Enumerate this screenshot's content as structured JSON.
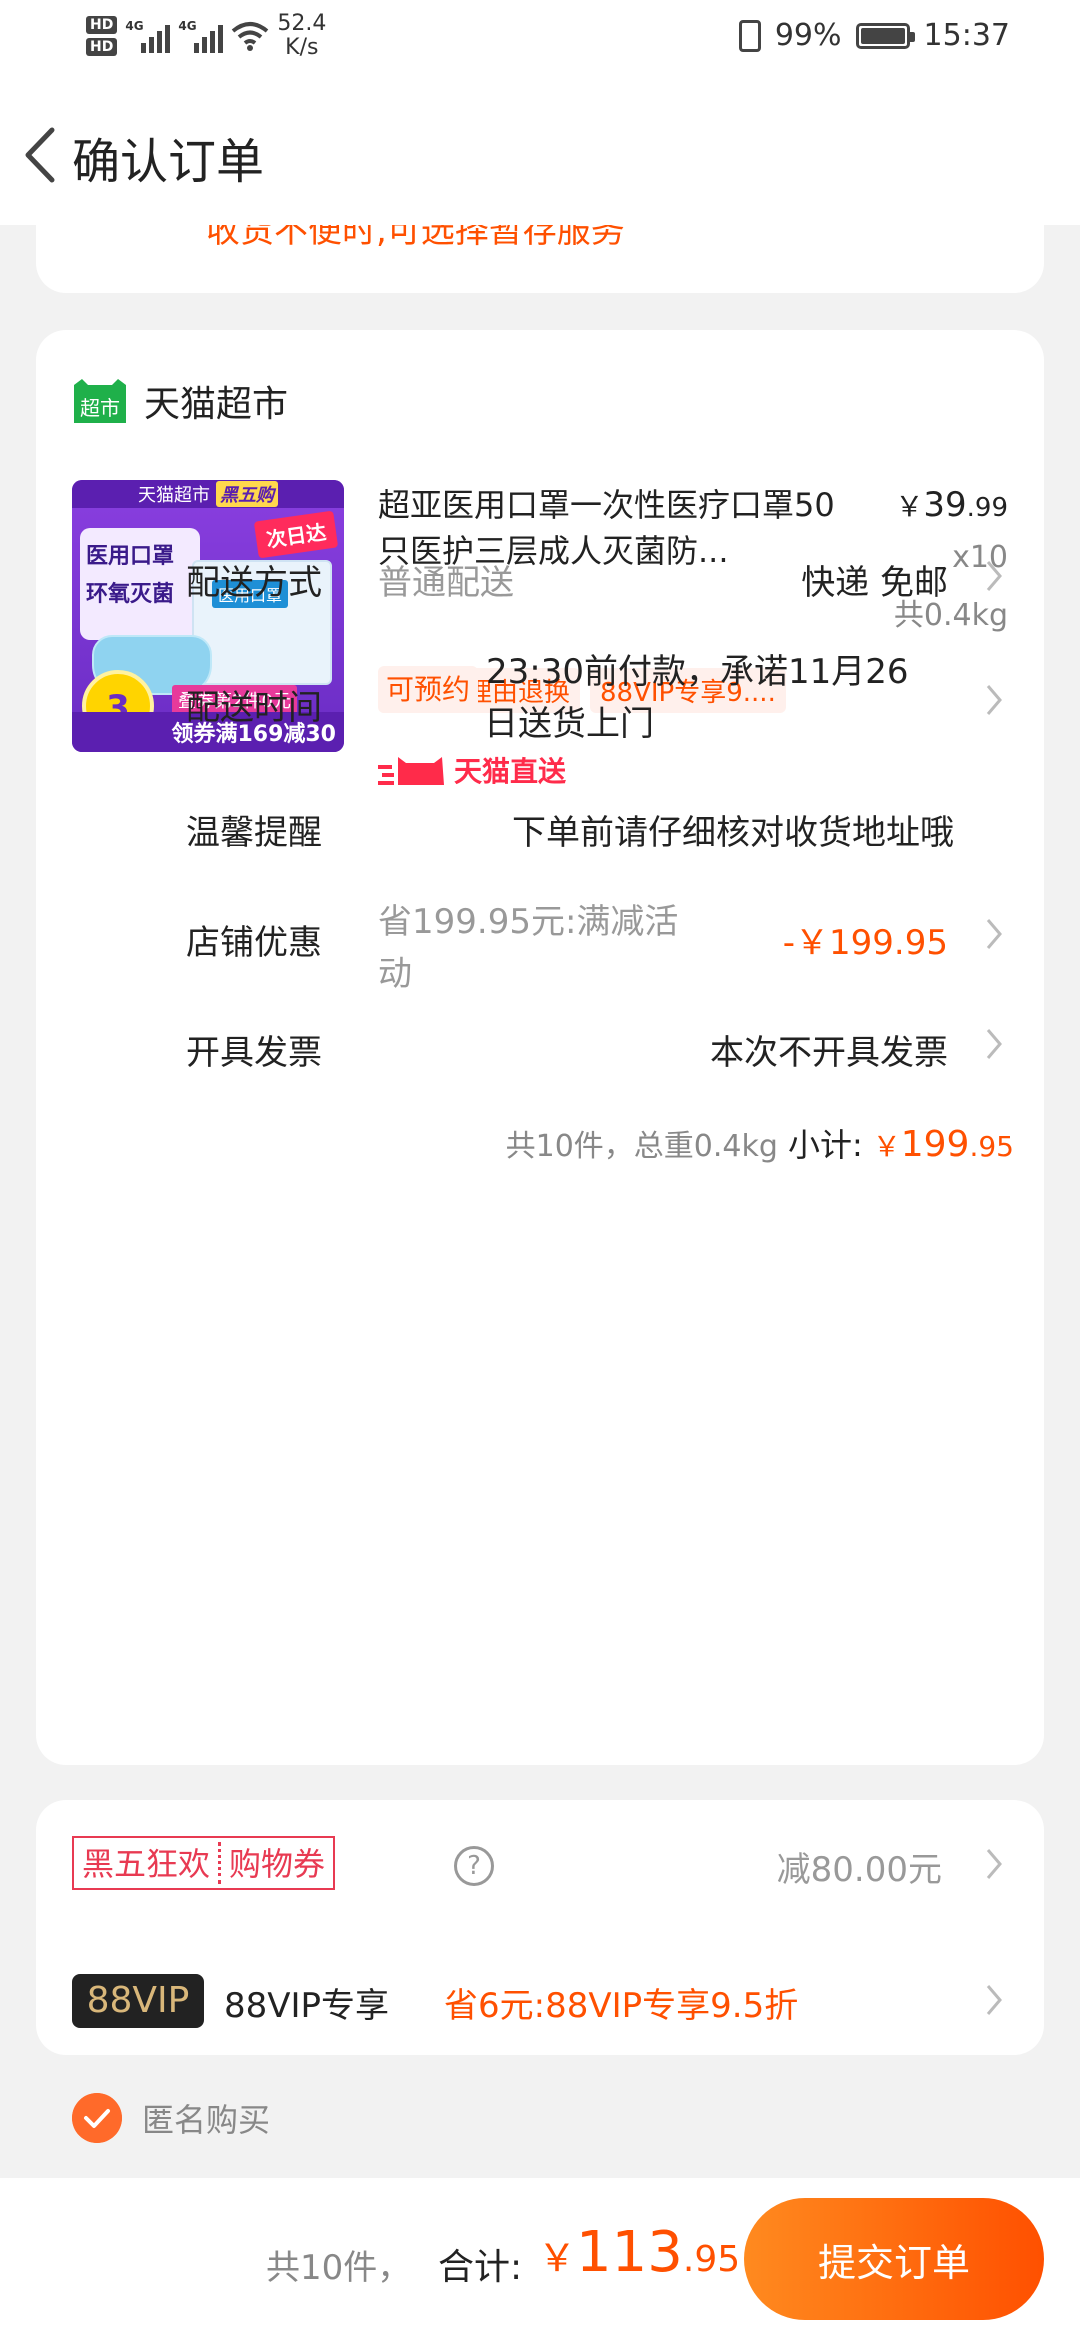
{
  "status_bar": {
    "hd1": "HD",
    "hd2": "HD",
    "net1": "4G",
    "net2": "4G",
    "speed_value": "52.4",
    "speed_unit": "K/s",
    "battery": "99%",
    "time": "15:37"
  },
  "nav": {
    "title": "确认订单"
  },
  "address_card": {
    "partial_text": "收货不便时,可选择暂存服务"
  },
  "shop": {
    "name": "天猫超市",
    "logo_text": "超市",
    "product": {
      "title": "超亚医用口罩一次性医疗口罩50只医护三层成人灭菌防...",
      "price_currency": "￥",
      "price_int": "39",
      "price_dec": ".99",
      "quantity": "x10",
      "weight": "共0.4kg",
      "tags": [
        "七天无理由退换",
        "88VIP专享9...."
      ],
      "image": {
        "band1": "天猫超市",
        "band2": "黑五购",
        "line1": "医用口罩",
        "line2": "环氧灭菌",
        "ribbon": "次日达",
        "box_label": "医用口罩",
        "circle_num": "3",
        "tag": "叠券第2件0元",
        "bottom": "领券满169减30"
      }
    }
  },
  "rows": {
    "delivery_method": {
      "label": "配送方式",
      "hint": "普通配送",
      "value": "快递 免邮"
    },
    "delivery_time": {
      "label": "配送时间",
      "badge": "可预约",
      "value": "23:30前付款，承诺11月26日送货上门",
      "value_line1": "23:30前付款，承诺11月26",
      "value_line2": "日送货上门",
      "direct": "天猫直送"
    },
    "reminder": {
      "label": "温馨提醒",
      "value": "下单前请仔细核对收货地址哦"
    },
    "shop_discount": {
      "label": "店铺优惠",
      "hint_line1": "省199.95元:满减活",
      "hint_line2": "动",
      "value": "-￥199.95"
    },
    "invoice": {
      "label": "开具发票",
      "value": "本次不开具发票"
    }
  },
  "subtotal": {
    "summary": "共10件，总重0.4kg",
    "label": "小计:",
    "currency": "￥",
    "int": "199",
    "dec": ".95"
  },
  "coupons": {
    "bf_part1": "黑五狂欢",
    "bf_part2": "购物券",
    "bf_help": "?",
    "bf_value": "减80.00元",
    "vip_logo": "88VIP",
    "vip_label": "88VIP专享",
    "vip_value": "省6元:88VIP专享9.5折"
  },
  "anonymous": {
    "label": "匿名购买",
    "checked": true
  },
  "bottom": {
    "count": "共10件，",
    "total_label": "合计:",
    "currency": "￥",
    "int": "113",
    "dec": ".95",
    "submit": "提交订单"
  },
  "colors": {
    "accent": "#ff5000",
    "bf_red": "#e83a52",
    "check": "#ff6a2a"
  }
}
